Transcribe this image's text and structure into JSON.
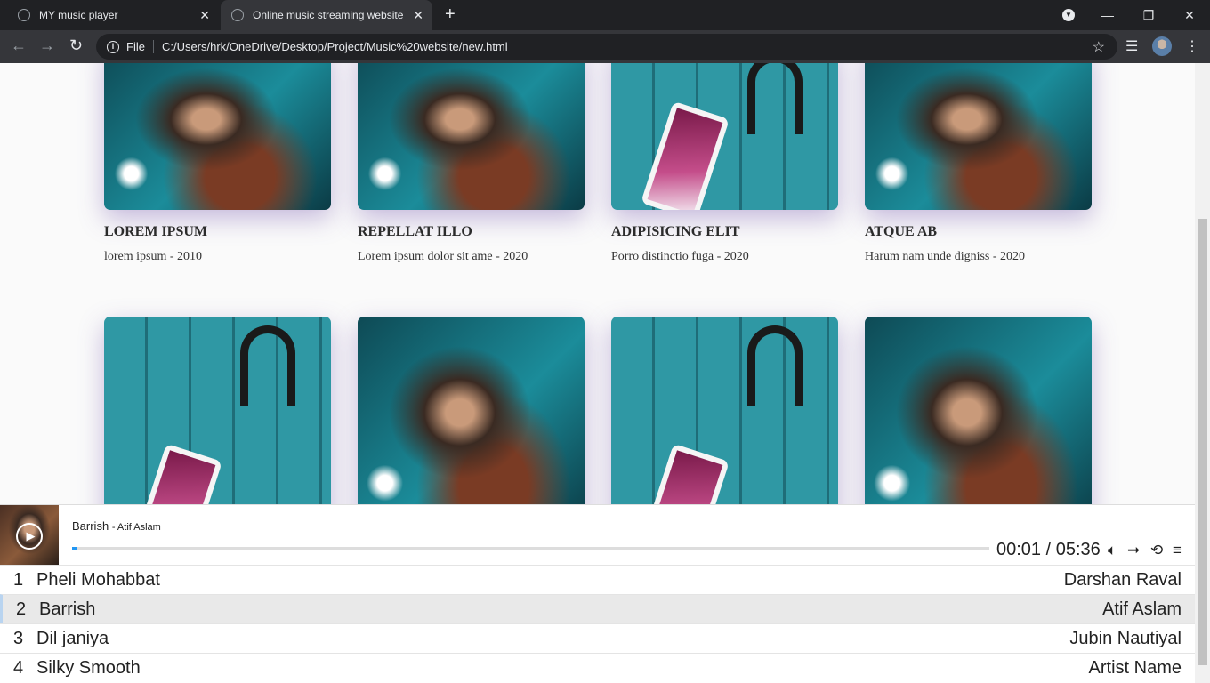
{
  "browser": {
    "tabs": [
      {
        "title": "MY music player",
        "active": false
      },
      {
        "title": "Online music streaming website (",
        "active": true
      }
    ],
    "address": {
      "scheme_label": "File",
      "url": "C:/Users/hrk/OneDrive/Desktop/Project/Music%20website/new.html"
    }
  },
  "cards": [
    {
      "title": "LOREM IPSUM",
      "subtitle": "lorem ipsum - 2010",
      "art": "singer"
    },
    {
      "title": "REPELLAT ILLO",
      "subtitle": "Lorem ipsum dolor sit ame - 2020",
      "art": "singer"
    },
    {
      "title": "ADIPISICING ELIT",
      "subtitle": "Porro distinctio fuga - 2020",
      "art": "phone-headphones"
    },
    {
      "title": "ATQUE AB",
      "subtitle": "Harum nam unde digniss - 2020",
      "art": "singer"
    },
    {
      "art": "phone-headphones"
    },
    {
      "art": "singer"
    },
    {
      "art": "phone-headphones"
    },
    {
      "art": "singer"
    }
  ],
  "player": {
    "now_playing": {
      "title": "Barrish",
      "artist": "- Atif Aslam"
    },
    "time": "00:01 / 05:36",
    "progress_fraction": 0.003,
    "controls": [
      "volume-icon",
      "next-icon",
      "repeat-icon",
      "playlist-icon"
    ],
    "accent_color": "#2196f3"
  },
  "playlist": [
    {
      "num": "1",
      "title": "Pheli Mohabbat",
      "artist": "Darshan Raval",
      "active": false
    },
    {
      "num": "2",
      "title": "Barrish",
      "artist": "Atif Aslam",
      "active": true
    },
    {
      "num": "3",
      "title": "Dil janiya",
      "artist": "Jubin Nautiyal",
      "active": false
    },
    {
      "num": "4",
      "title": "Silky Smooth",
      "artist": "Artist Name",
      "active": false
    }
  ]
}
